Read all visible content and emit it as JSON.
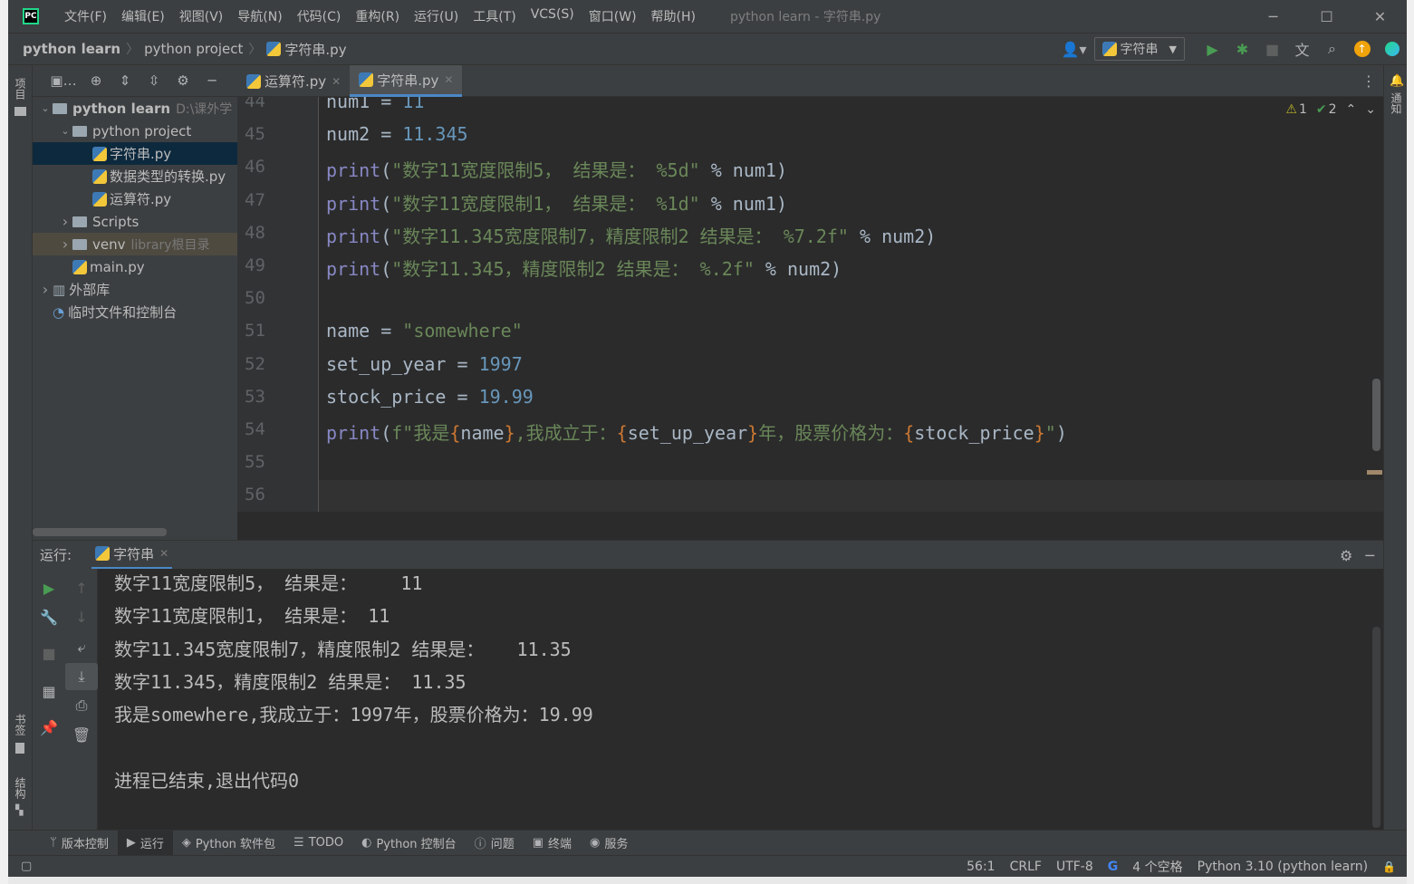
{
  "window": {
    "title": "python learn - 字符串.py",
    "menu": [
      "文件(F)",
      "编辑(E)",
      "视图(V)",
      "导航(N)",
      "代码(C)",
      "重构(R)",
      "运行(U)",
      "工具(T)",
      "VCS(S)",
      "窗口(W)",
      "帮助(H)"
    ],
    "logo_text": "PC"
  },
  "breadcrumb": [
    "python learn",
    "python project",
    "字符串.py"
  ],
  "run_config": "字符串",
  "left_strip": {
    "project_tab": "项目",
    "bookmarks_tab": "书签",
    "structure_tab": "结构"
  },
  "right_strip": {
    "notifications_tab": "通知"
  },
  "project_tree": [
    {
      "label": "python learn",
      "extra": "D:\\课外学",
      "type": "folder",
      "indent": 0,
      "arrow": "v",
      "bold": true
    },
    {
      "label": "python project",
      "extra": "",
      "type": "folder",
      "indent": 1,
      "arrow": "v"
    },
    {
      "label": "字符串.py",
      "extra": "",
      "type": "py",
      "indent": 2,
      "arrow": "",
      "selected": true
    },
    {
      "label": "数据类型的转换.py",
      "extra": "",
      "type": "py",
      "indent": 2,
      "arrow": ""
    },
    {
      "label": "运算符.py",
      "extra": "",
      "type": "py",
      "indent": 2,
      "arrow": ""
    },
    {
      "label": "Scripts",
      "extra": "",
      "type": "folder",
      "indent": 1,
      "arrow": ">"
    },
    {
      "label": "venv",
      "extra": "library根目录",
      "type": "folder",
      "indent": 1,
      "arrow": ">",
      "excluded": true
    },
    {
      "label": "main.py",
      "extra": "",
      "type": "py",
      "indent": 1,
      "arrow": ""
    },
    {
      "label": "外部库",
      "extra": "",
      "type": "lib",
      "indent": 0,
      "arrow": ">"
    },
    {
      "label": "临时文件和控制台",
      "extra": "",
      "type": "scratch",
      "indent": 0,
      "arrow": ""
    }
  ],
  "editor_tabs": [
    {
      "label": "运算符.py",
      "active": false
    },
    {
      "label": "字符串.py",
      "active": true
    }
  ],
  "inspections": {
    "warnings": "1",
    "ok": "2"
  },
  "line_numbers": [
    "44",
    "45",
    "46",
    "47",
    "48",
    "49",
    "50",
    "51",
    "52",
    "53",
    "54",
    "55",
    "56"
  ],
  "code_lines": [
    [
      {
        "t": "num1 = ",
        "c": ""
      },
      {
        "t": "11",
        "c": "k-num"
      }
    ],
    [
      {
        "t": "num2 = ",
        "c": ""
      },
      {
        "t": "11.345",
        "c": "k-num"
      }
    ],
    [
      {
        "t": "print",
        "c": "k-fn"
      },
      {
        "t": "(",
        "c": ""
      },
      {
        "t": "\"数字11宽度限制5， 结果是： %5d\"",
        "c": "k-str"
      },
      {
        "t": " % num1)",
        "c": ""
      }
    ],
    [
      {
        "t": "print",
        "c": "k-fn"
      },
      {
        "t": "(",
        "c": ""
      },
      {
        "t": "\"数字11宽度限制1， 结果是： %1d\"",
        "c": "k-str"
      },
      {
        "t": " % num1)",
        "c": ""
      }
    ],
    [
      {
        "t": "print",
        "c": "k-fn"
      },
      {
        "t": "(",
        "c": ""
      },
      {
        "t": "\"数字11.345宽度限制7，精度限制2 结果是： %7.2f\"",
        "c": "k-str"
      },
      {
        "t": " % num2)",
        "c": ""
      }
    ],
    [
      {
        "t": "print",
        "c": "k-fn"
      },
      {
        "t": "(",
        "c": ""
      },
      {
        "t": "\"数字11.345，精度限制2 结果是： %.2f\"",
        "c": "k-str"
      },
      {
        "t": " % num2)",
        "c": ""
      }
    ],
    [],
    [
      {
        "t": "name = ",
        "c": ""
      },
      {
        "t": "\"somewhere\"",
        "c": "k-str"
      }
    ],
    [
      {
        "t": "set_up_year = ",
        "c": ""
      },
      {
        "t": "1997",
        "c": "k-num"
      }
    ],
    [
      {
        "t": "stock_price = ",
        "c": ""
      },
      {
        "t": "19.99",
        "c": "k-num"
      }
    ],
    [
      {
        "t": "print",
        "c": "k-fn"
      },
      {
        "t": "(",
        "c": ""
      },
      {
        "t": "f\"我是",
        "c": "k-str"
      },
      {
        "t": "{",
        "c": "k-brace"
      },
      {
        "t": "name",
        "c": ""
      },
      {
        "t": "}",
        "c": "k-brace"
      },
      {
        "t": ",我成立于：",
        "c": "k-str"
      },
      {
        "t": "{",
        "c": "k-brace"
      },
      {
        "t": "set_up_year",
        "c": ""
      },
      {
        "t": "}",
        "c": "k-brace"
      },
      {
        "t": "年，股票价格为：",
        "c": "k-str"
      },
      {
        "t": "{",
        "c": "k-brace"
      },
      {
        "t": "stock_price",
        "c": ""
      },
      {
        "t": "}",
        "c": "k-brace"
      },
      {
        "t": "\"",
        "c": "k-str"
      },
      {
        "t": ")",
        "c": ""
      }
    ],
    [],
    []
  ],
  "run_panel": {
    "label": "运行:",
    "tab": "字符串",
    "output": [
      "数字11宽度限制5， 结果是：    11",
      "数字11宽度限制1， 结果是： 11",
      "数字11.345宽度限制7，精度限制2 结果是：   11.35",
      "数字11.345，精度限制2 结果是： 11.35",
      "我是somewhere,我成立于：1997年，股票价格为：19.99",
      "",
      "进程已结束,退出代码0"
    ]
  },
  "bottom_tools": [
    {
      "label": "版本控制",
      "icon": "branch-icon",
      "glyph": "ᛘ",
      "active": false
    },
    {
      "label": "运行",
      "icon": "run-icon",
      "glyph": "▶",
      "active": true
    },
    {
      "label": "Python 软件包",
      "icon": "packages-icon",
      "glyph": "◈",
      "active": false
    },
    {
      "label": "TODO",
      "icon": "todo-icon",
      "glyph": "☰",
      "active": false
    },
    {
      "label": "Python 控制台",
      "icon": "python-console-icon",
      "glyph": "◐",
      "active": false
    },
    {
      "label": "问题",
      "icon": "problems-icon",
      "glyph": "ⓘ",
      "active": false
    },
    {
      "label": "终端",
      "icon": "terminal-icon",
      "glyph": "▣",
      "active": false
    },
    {
      "label": "服务",
      "icon": "services-icon",
      "glyph": "◉",
      "active": false
    }
  ],
  "status": {
    "position": "56:1",
    "line_sep": "CRLF",
    "encoding": "UTF-8",
    "indent": "4 个空格",
    "interpreter": "Python 3.10 (python learn)"
  },
  "colors": {
    "accent": "#4a88c7",
    "run_green": "#499c54",
    "warning": "#bbb529"
  }
}
